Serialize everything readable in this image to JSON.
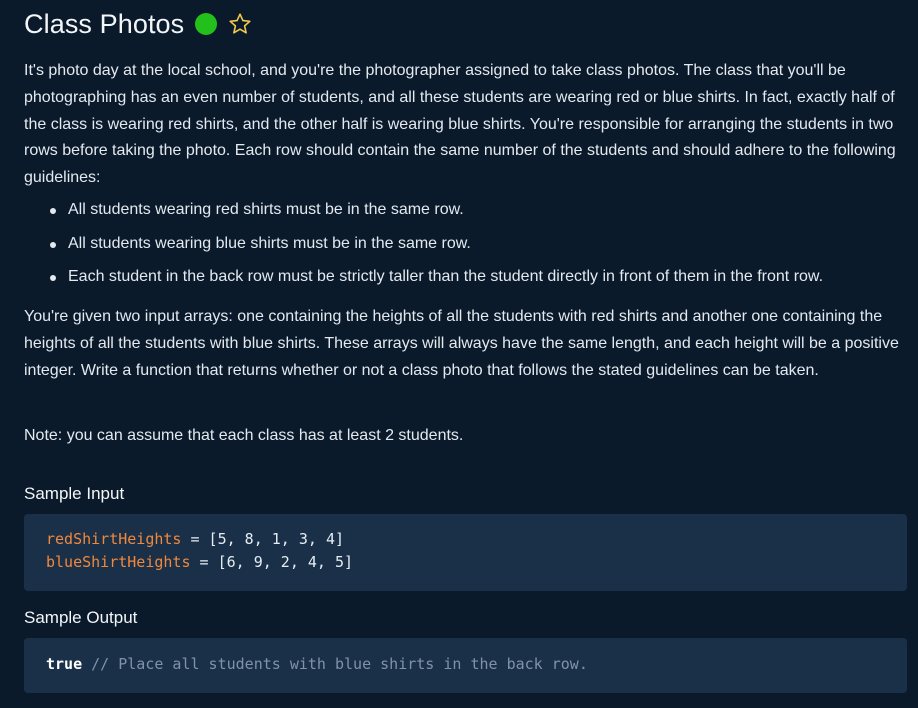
{
  "header": {
    "title": "Class Photos",
    "status_color": "#23c01c",
    "star_icon": "star-outline-icon",
    "star_color": "#f2c94c"
  },
  "description": {
    "paragraph1": "It's photo day at the local school, and you're the photographer assigned to take class photos. The class that you'll be photographing has an even number of students, and all these students are wearing red or blue shirts. In fact, exactly half of the class is wearing red shirts, and the other half is wearing blue shirts. You're responsible for arranging the students in two rows before taking the photo. Each row should contain the same number of the students and should adhere to the following guidelines:",
    "bullets": [
      "All students wearing red shirts must be in the same row.",
      "All students wearing blue shirts must be in the same row.",
      "Each student in the back row must be strictly taller than the student directly in front of them in the front row."
    ],
    "paragraph2": "You're given two input arrays: one containing the heights of all the students with red shirts and another one containing the heights of all the students with blue shirts. These arrays will always have the same length, and each height will be a positive integer. Write a function that returns whether or not a class photo that follows the stated guidelines can be taken.",
    "note": "Note: you can assume that each class has at least 2 students."
  },
  "sample_input": {
    "title": "Sample Input",
    "lines": [
      {
        "name": "redShirtHeights",
        "rest": " = [5, 8, 1, 3, 4]"
      },
      {
        "name": "blueShirtHeights",
        "rest": " = [6, 9, 2, 4, 5]"
      }
    ]
  },
  "sample_output": {
    "title": "Sample Output",
    "value": "true",
    "comment": " // Place all students with blue shirts in the back row."
  }
}
